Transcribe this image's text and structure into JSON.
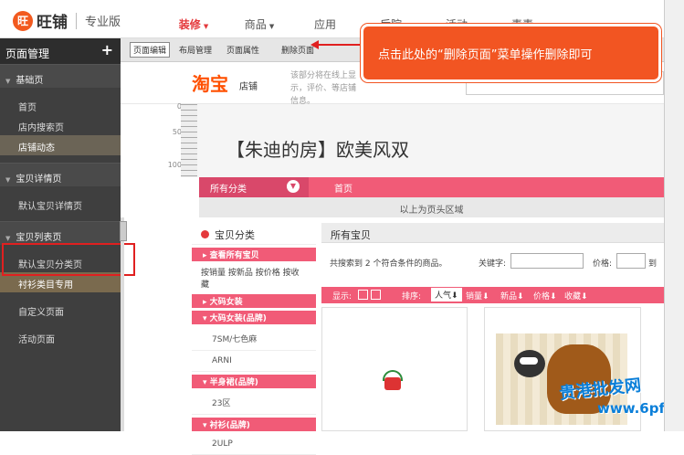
{
  "app": {
    "logo_mark": "旺",
    "name": "旺铺",
    "edition": "专业版"
  },
  "nav": [
    {
      "label": "装修",
      "caret": true,
      "active": true
    },
    {
      "label": "商品",
      "caret": true,
      "active": false
    },
    {
      "label": "应用",
      "caret": false,
      "active": false
    },
    {
      "label": "后院",
      "caret": false,
      "active": false
    },
    {
      "label": "活动",
      "caret": false,
      "active": false
    },
    {
      "label": "素素",
      "caret": false,
      "active": false
    }
  ],
  "sidebar": {
    "title": "页面管理",
    "add": "+",
    "groups": [
      {
        "label": "基础页",
        "items": [
          "首页",
          "店内搜索页",
          "店铺动态"
        ]
      },
      {
        "label": "宝贝详情页",
        "items": [
          "默认宝贝详情页"
        ]
      },
      {
        "label": "宝贝列表页",
        "items": [
          "默认宝贝分类页",
          "衬衫类目专用"
        ]
      }
    ],
    "extra_items": [
      "自定义页面",
      "活动页面"
    ]
  },
  "toolbar": [
    "页面编辑",
    "布局管理",
    "页面属性",
    "删除页面"
  ],
  "callout": "点击此处的“删除页面”菜单操作删除即可",
  "taobao": {
    "logo": "淘宝",
    "sub": "店铺",
    "desc": "该部分将在线上显示，评价、等店铺信息。"
  },
  "ruler": [
    "0",
    "50",
    "100"
  ],
  "banner": {
    "store_title": "【朱迪的房】欧美风双"
  },
  "pinknav": {
    "all": "所有分类",
    "home": "首页",
    "header_area": "以上为页头区域"
  },
  "catpanel": {
    "title": "宝贝分类",
    "view_all": "查看所有宝贝",
    "sort_text": "按销量 按新品 按价格 按收藏",
    "cats": [
      {
        "bar": "大码女装",
        "subs": []
      },
      {
        "bar": "大码女装(品牌)",
        "subs": [
          "7SM/七色麻",
          "ARNI"
        ]
      },
      {
        "bar": "半身裙(品牌)",
        "subs": [
          "23区"
        ]
      },
      {
        "bar": "衬衫(品牌)",
        "subs": [
          "2ULP"
        ]
      }
    ]
  },
  "mainpanel": {
    "title": "所有宝贝",
    "count": "共搜索到 2 个符合条件的商品。",
    "keyword_label": "关键字:",
    "price_label": "价格:",
    "to": "到",
    "sort": {
      "display": "显示:",
      "order": "排序:",
      "popularity": "人气",
      "sales": "销量",
      "new": "新品",
      "price": "价格",
      "fav": "收藏"
    }
  },
  "watermark": {
    "brand": "贵港批发网",
    "url": "www.6pf.cn"
  }
}
